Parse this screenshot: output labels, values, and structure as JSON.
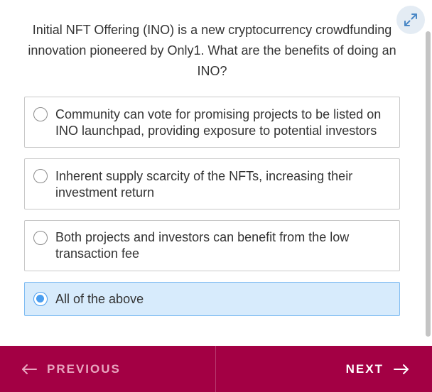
{
  "quiz": {
    "question": "Initial NFT Offering (INO) is a new cryptocurrency crowdfunding innovation pioneered by Only1. What are the benefits of doing an INO?",
    "options": [
      {
        "label": "Community can vote for promising projects to be listed on INO launchpad, providing exposure to potential investors",
        "selected": false
      },
      {
        "label": "Inherent supply scarcity of the NFTs, increasing their investment return",
        "selected": false
      },
      {
        "label": "Both projects and investors can benefit from the low transaction fee",
        "selected": false
      },
      {
        "label": "All of the above",
        "selected": true
      }
    ]
  },
  "nav": {
    "previous_label": "PREVIOUS",
    "next_label": "NEXT"
  },
  "icons": {
    "expand": "expand-icon",
    "arrow_left": "arrow-left-icon",
    "arrow_right": "arrow-right-icon"
  },
  "colors": {
    "footer": "#a30044",
    "selected_bg": "#d7ebfc",
    "radio_selected": "#4a9ef0",
    "expand_bg": "#e4ecf4"
  }
}
